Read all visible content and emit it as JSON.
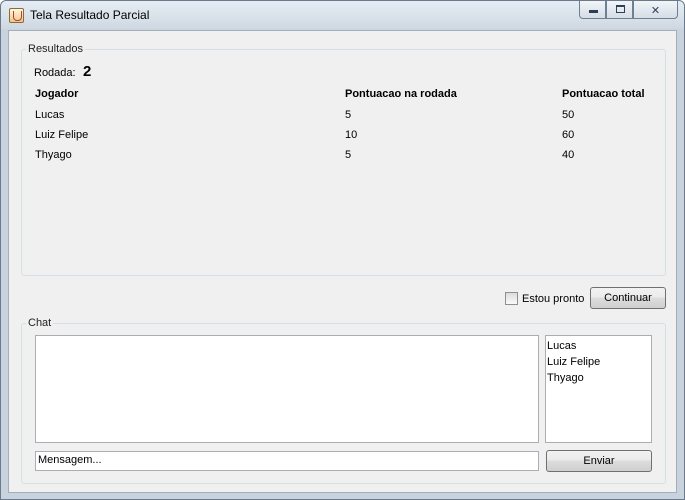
{
  "window": {
    "title": "Tela Resultado Parcial"
  },
  "resultados": {
    "group_label": "Resultados",
    "rodada_label": "Rodada:",
    "rodada_value": "2",
    "columns": [
      "Jogador",
      "Pontuacao na rodada",
      "Pontuacao total"
    ],
    "rows": [
      {
        "jogador": "Lucas",
        "rodada": "5",
        "total": "50"
      },
      {
        "jogador": "Luiz Felipe",
        "rodada": "10",
        "total": "60"
      },
      {
        "jogador": "Thyago",
        "rodada": "5",
        "total": "40"
      }
    ]
  },
  "controls": {
    "ready_label": "Estou pronto",
    "ready_checked": false,
    "continue_label": "Continuar"
  },
  "chat": {
    "group_label": "Chat",
    "messages": "",
    "players": [
      "Lucas",
      "Luiz Felipe",
      "Thyago"
    ],
    "message_placeholder": "Mensagem...",
    "send_label": "Enviar"
  }
}
